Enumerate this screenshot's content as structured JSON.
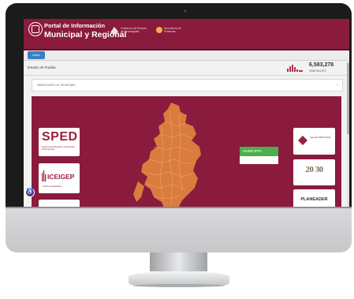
{
  "header": {
    "title_line1": "Portal de Información",
    "title_line2": "Municipal y Regional",
    "gov_logo_line1": "Gobierno del Estado",
    "gov_logo_line2": "de Guanajuato",
    "secretaria_line1": "Secretaría de",
    "secretaria_line2": "Finanzas"
  },
  "tab": {
    "label": "Inicio"
  },
  "breadcrumb": "Estado de Puebla",
  "population": {
    "value": "6,583,278",
    "label": "HABITANTES"
  },
  "selector": {
    "placeholder": "Seleccione un municipio",
    "chevron": "⌄"
  },
  "logos": {
    "sped_title": "SPED",
    "sped_sub": "Sistema de Planeación y Evaluación del Desarrollo",
    "iceigep_title": "ICEIGEP",
    "iceigep_sub": "Instituto de Estadística",
    "right_top_text": "Agenda 2030 Puebla",
    "right_mid_text": "20 30",
    "right_bottom_text": "PLANEADER"
  },
  "legend": {
    "label": "MUNICIPIO"
  },
  "accessibility": {
    "glyph": "♿"
  },
  "colors": {
    "brand": "#8a1b3c",
    "map_fill": "#d97c3d",
    "legend_green": "#4cae4c",
    "tab_blue": "#3a7fc1"
  },
  "icons": [
    "logo-icon",
    "gov-logo-icon",
    "secretaria-icon",
    "chart-icon",
    "chevron-down-icon",
    "accessibility-icon"
  ]
}
